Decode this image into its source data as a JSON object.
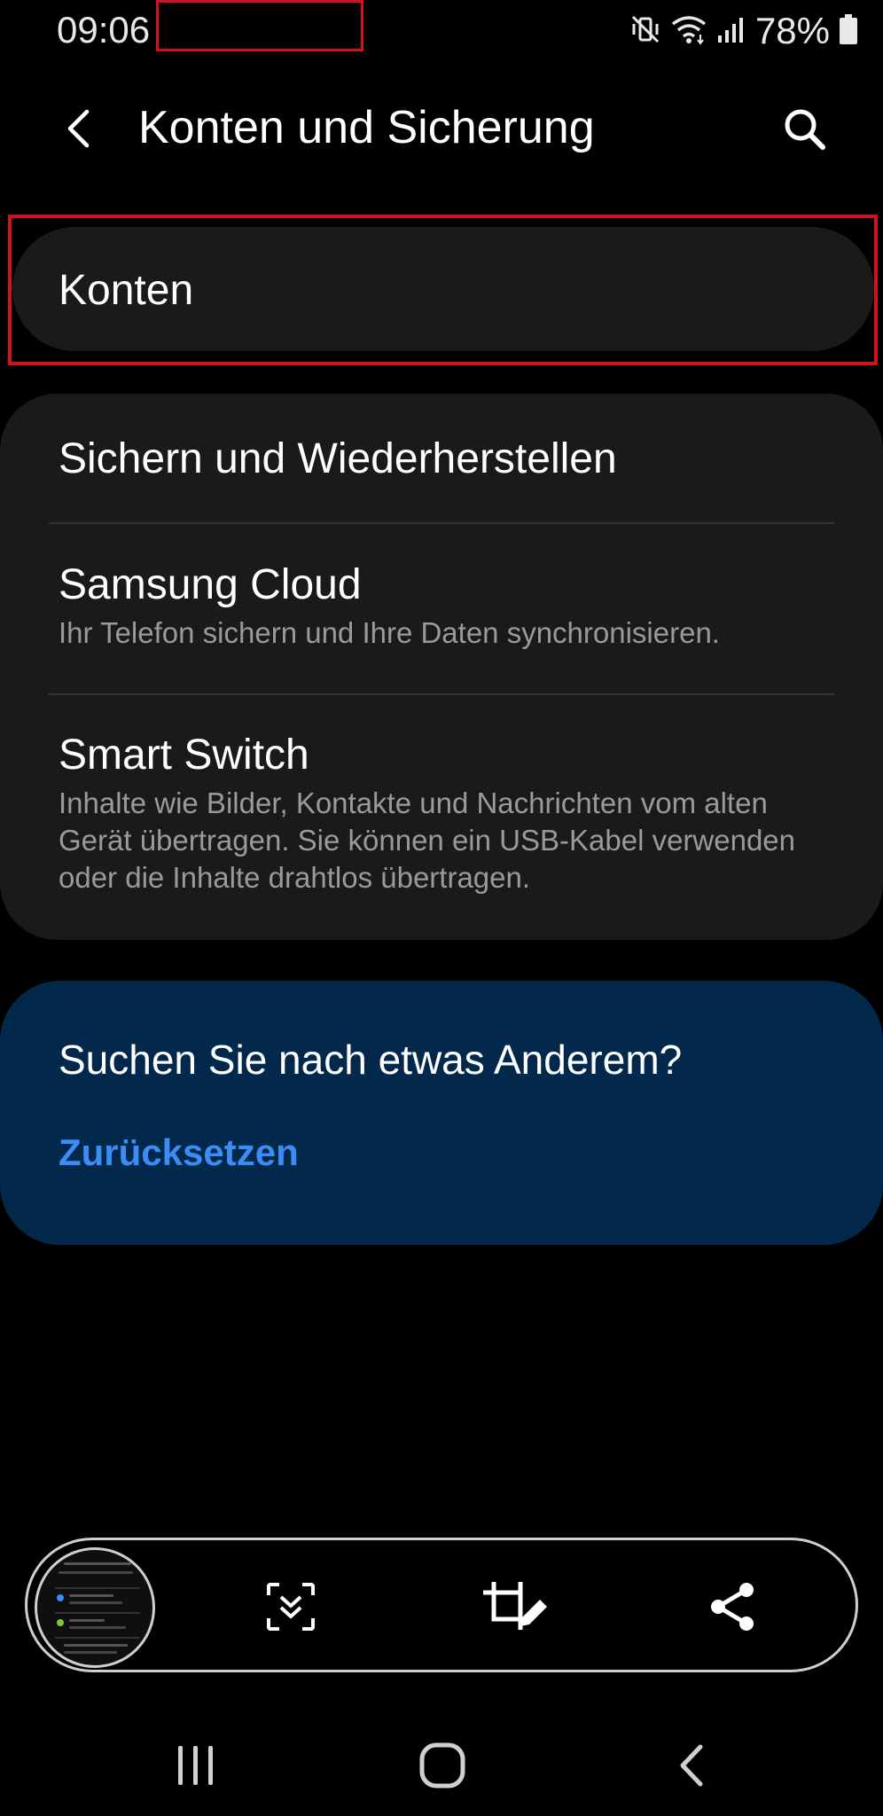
{
  "status_bar": {
    "time": "09:06",
    "battery": "78%",
    "icons": [
      "mute-vibrate-icon",
      "wifi-icon",
      "signal-icon",
      "battery-icon"
    ]
  },
  "app_bar": {
    "title": "Konten und Sicherung",
    "back_icon": "chevron-left-icon",
    "search_icon": "search-icon"
  },
  "menu": {
    "konten": {
      "title": "Konten"
    },
    "items": [
      {
        "title": "Sichern und Wiederherstellen",
        "subtitle": ""
      },
      {
        "title": "Samsung Cloud",
        "subtitle": "Ihr Telefon sichern und Ihre Daten synchronisieren."
      },
      {
        "title": "Smart Switch",
        "subtitle": "Inhalte wie Bilder, Kontakte und Nachrichten vom alten Gerät übertragen. Sie können ein USB-Kabel verwenden oder die Inhalte drahtlos übertragen."
      }
    ]
  },
  "suggestion": {
    "title": "Suchen Sie nach etwas Anderem?",
    "link": "Zurücksetzen"
  },
  "screenshot_toolbar": {
    "icons": [
      "screenshot-thumbnail",
      "scroll-capture-icon",
      "crop-edit-icon",
      "share-icon"
    ]
  },
  "nav_bar": {
    "icons": [
      "recent-apps-icon",
      "home-icon",
      "back-icon"
    ]
  },
  "colors": {
    "background": "#000000",
    "card": "#1a1a1a",
    "suggestion_card": "#02294c",
    "link": "#3b8cf5",
    "annotation": "#d0141e",
    "subtitle": "#9a9a9a"
  }
}
